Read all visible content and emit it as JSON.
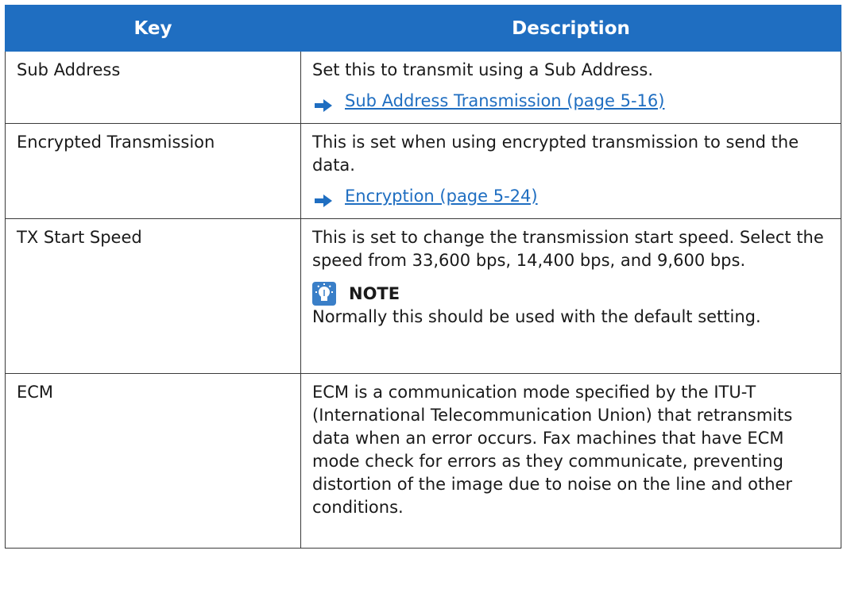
{
  "header": {
    "key": "Key",
    "description": "Description"
  },
  "rows": [
    {
      "key": "Sub Address",
      "text": "Set this to transmit using a Sub Address.",
      "link": "Sub Address Transmission (page 5-16)"
    },
    {
      "key": "Encrypted Transmission",
      "text": "This is set when using encrypted transmission to send the data.",
      "link": "Encryption (page 5-24)"
    },
    {
      "key": "TX Start Speed",
      "text": "This is set to change the transmission start speed. Select the speed from 33,600 bps, 14,400 bps, and 9,600 bps.",
      "note_title": "NOTE",
      "note_text": "Normally this should be used with the default setting."
    },
    {
      "key": "ECM",
      "text": "ECM is a communication mode specified by the ITU-T (International Telecommunication Union) that retransmits data when an error occurs. Fax machines that have ECM mode check for errors as they communicate, preventing distortion of the image due to noise on the line and other conditions."
    }
  ],
  "colors": {
    "header_bg": "#1f6ec1",
    "link": "#1f6ec1",
    "border": "#3a3a3a"
  }
}
